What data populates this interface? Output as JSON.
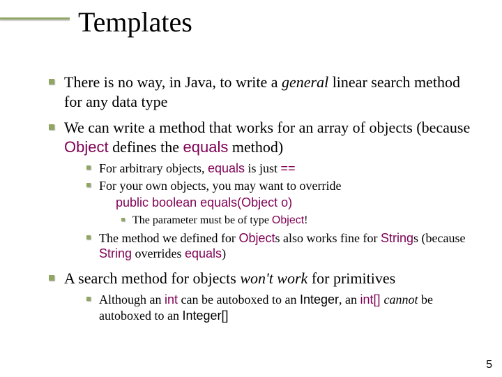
{
  "title": "Templates",
  "b1": {
    "p1a": "There is no way, in Java, to write a ",
    "p1b": "general",
    "p1c": " linear search method for any data type",
    "p2a": "We can write a method that works for an array of objects (because ",
    "p2b": "Object",
    "p2c": " defines the ",
    "p2d": "equals",
    "p2e": " method)",
    "p3a": "A search method for objects ",
    "p3b": "won't work",
    "p3c": " for primitives"
  },
  "b2": {
    "a1": "For arbitrary objects, ",
    "a2": "equals",
    "a3": " is just ",
    "a4": "==",
    "b1": "For your own objects, you may want to override",
    "codeline": "public boolean equals(Object o)",
    "c1": "The method we defined for ",
    "c2": "Object",
    "c3": "s also works fine for ",
    "c4": "String",
    "c5": "s (because ",
    "c6": "String",
    "c7": " overrides ",
    "c8": "equals",
    "c9": ")",
    "d1": "Although an ",
    "d2": "int",
    "d3": " can be autoboxed to an ",
    "d4": "Integer",
    "d5": ", an ",
    "d6": "int[] ",
    "d7": "cannot",
    "d8": " be autoboxed to an ",
    "d9": "Integer[]"
  },
  "b3": {
    "a1": "The parameter must be of type ",
    "a2": "Object",
    "a3": "!"
  },
  "pageNumber": "5"
}
